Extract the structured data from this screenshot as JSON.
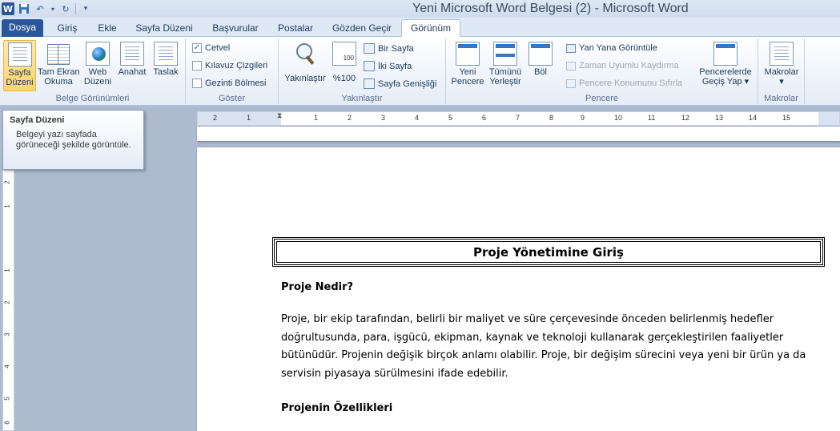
{
  "window": {
    "title": "Yeni Microsoft Word Belgesi (2)  -  Microsoft Word"
  },
  "tabs": [
    {
      "label": "Dosya"
    },
    {
      "label": "Giriş"
    },
    {
      "label": "Ekle"
    },
    {
      "label": "Sayfa Düzeni"
    },
    {
      "label": "Başvurular"
    },
    {
      "label": "Postalar"
    },
    {
      "label": "Gözden Geçir"
    },
    {
      "label": "Görünüm"
    }
  ],
  "ribbon": {
    "belge": {
      "label": "Belge Görünümleri",
      "sayfa_duzeni": "Sayfa\nDüzeni",
      "tam_ekran": "Tam Ekran\nOkuma",
      "web": "Web\nDüzeni",
      "anahat": "Anahat",
      "taslak": "Taslak"
    },
    "goster": {
      "label": "Göster",
      "cetvel": "Cetvel",
      "cetvel_checked": true,
      "kilavuz": "Kılavuz Çizgileri",
      "gezinti": "Gezinti Bölmesi"
    },
    "yakinlastir": {
      "label": "Yakınlaştır",
      "yakinlastir_btn": "Yakınlaştır",
      "yuzde": "%100",
      "page_icon_text": "100",
      "bir_sayfa": "Bir Sayfa",
      "iki_sayfa": "İki Sayfa",
      "sayfa_genisligi": "Sayfa Genişliği"
    },
    "pencere": {
      "label": "Pencere",
      "yeni": "Yeni\nPencere",
      "tumunu": "Tümünü\nYerleştir",
      "bol": "Böl",
      "yan_yana": "Yan Yana Görüntüle",
      "zaman": "Zaman Uyumlu Kaydırma",
      "konum": "Pencere Konumunu Sıfırla",
      "gecis": "Pencerelerde\nGeçiş Yap ▾"
    },
    "makrolar": {
      "label": "Makrolar",
      "btn": "Makrolar\n▾"
    }
  },
  "ruler": {
    "numbers": [
      "2",
      "1",
      "1",
      "2",
      "3",
      "4",
      "5",
      "6",
      "7",
      "8",
      "9",
      "10",
      "11",
      "12",
      "13",
      "14",
      "15"
    ],
    "vnumbers": [
      "2",
      "1",
      "1",
      "2",
      "3",
      "4",
      "5",
      "6"
    ]
  },
  "tooltip": {
    "title": "Sayfa Düzeni",
    "body": "Belgeyi yazı sayfada görüneceği şekilde görüntüle."
  },
  "document": {
    "title": "Proje Yönetimine Giriş",
    "heading1": "Proje Nedir?",
    "paragraph1": "Proje, bir ekip tarafından, belirli bir maliyet ve süre çerçevesinde önceden  belirlenmiş hedefler doğrultusunda,  para, işgücü, ekipman, kaynak ve teknoloji kullanarak gerçekleştirilen faaliyetler bütünüdür.  Projenin değişik birçok anlamı olabilir. Proje, bir değişim sürecini veya yeni bir ürün ya da servisin piyasaya sürülmesini ifade edebilir.",
    "heading2": "Projenin Özellikleri"
  }
}
